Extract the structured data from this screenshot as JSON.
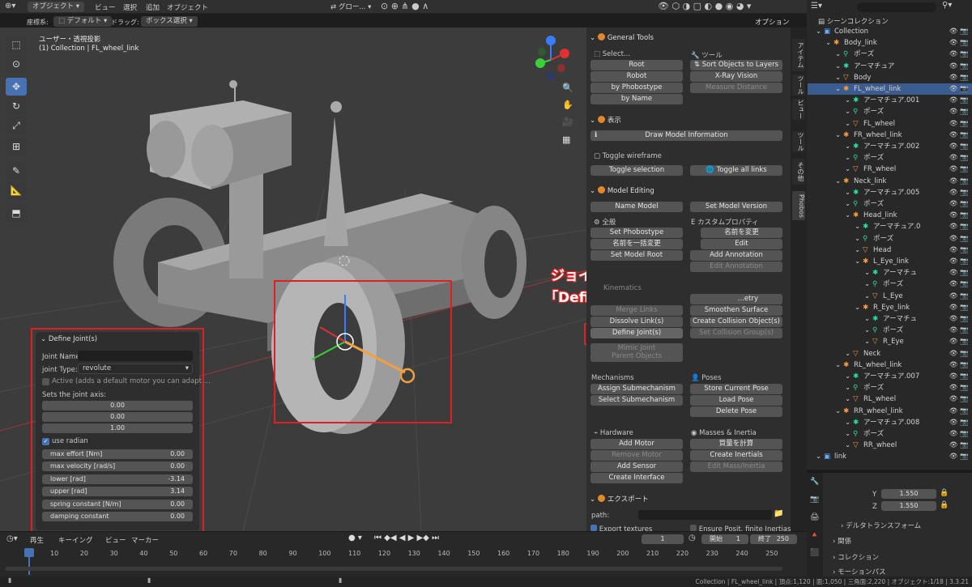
{
  "topbar": {
    "mode": "オブジェクト",
    "menus": [
      "ビュー",
      "選択",
      "追加",
      "オブジェクト"
    ],
    "transform_global": "グロー...",
    "options": "オプション"
  },
  "toolbar2": {
    "coord_label": "座標系:",
    "coord_value": "デフォルト",
    "drag_label": "ドラッグ:",
    "drag_value": "ボックス選択"
  },
  "viewport": {
    "title": "ユーザー・透視投影",
    "subtitle": "(1) Collection | FL_wheel_link"
  },
  "annotation": {
    "line1": "ジョイントを選択後",
    "line2": "「Define Joint(s)」を押す"
  },
  "define_joint": {
    "title": "Define Joint(s)",
    "joint_name_label": "Joint Name:",
    "joint_name_value": "",
    "joint_type_label": "joint Type:",
    "joint_type_value": "revolute",
    "active_label": "Active (adds a default motor you can adapt ...",
    "axis_label": "Sets the joint axis:",
    "axis": [
      "0.00",
      "0.00",
      "1.00"
    ],
    "use_radian": "use radian",
    "fields": [
      {
        "k": "max effort [Nm]",
        "v": "0.00"
      },
      {
        "k": "max velocity [rad/s]",
        "v": "0.00"
      },
      {
        "k": "lower [rad]",
        "v": "-3.14"
      },
      {
        "k": "upper [rad]",
        "v": "3.14"
      },
      {
        "k": "spring constant [N/m]",
        "v": "0.00"
      },
      {
        "k": "damping constant",
        "v": "0.00"
      }
    ]
  },
  "phobos": {
    "general_tools": "General Tools",
    "select": "Select...",
    "tools": "ツール",
    "root": "Root",
    "sort_layers": "Sort Objects to Layers",
    "robot": "Robot",
    "xray": "X-Ray Vision",
    "by_phobostype": "by Phobostype",
    "measure": "Measure Distance",
    "by_name": "by Name",
    "display": "表示",
    "draw_model_info": "Draw Model Information",
    "toggle_wireframe": "Toggle wireframe",
    "toggle_selection": "Toggle selection",
    "toggle_all_links": "Toggle all links",
    "model_editing": "Model Editing",
    "name_model": "Name Model",
    "set_model_version": "Set Model Version",
    "general": "全般",
    "custom_props": "カスタムプロパティ",
    "set_phobostype": "Set Phobostype",
    "rename": "名前を変更",
    "batch_rename": "名前を一括変更",
    "edit": "Edit",
    "set_model_root": "Set Model Root",
    "add_annotation": "Add Annotation",
    "edit_annotation": "Edit Annotation",
    "kinematics": "Kinematics",
    "geometry": "...etry",
    "merge_links": "Merge Links",
    "smoothen_surface": "Smoothen Surface",
    "dissolve_links": "Dissolve Link(s)",
    "create_collision": "Create Collision Object(s)",
    "define_joints": "Define Joint(s)",
    "set_collision_groups": "Set Collision Group(s)",
    "mimic_joint": "Mimic Joint",
    "parent_objects": "Parent Objects",
    "mechanisms": "Mechanisms",
    "poses": "Poses",
    "assign_submech": "Assign Submechanism",
    "store_pose": "Store Current Pose",
    "select_submech": "Select Submechanism",
    "load_pose": "Load Pose",
    "delete_pose": "Delete Pose",
    "hardware": "Hardware",
    "masses": "Masses & Inertia",
    "add_motor": "Add Motor",
    "calc_mass": "質量を計算",
    "remove_motor": "Remove Motor",
    "create_inertials": "Create Inertials",
    "add_sensor": "Add Sensor",
    "edit_mass": "Edit Mass/Inertia",
    "create_interface": "Create Interface",
    "export": "エクスポート",
    "path": "path:",
    "export_textures": "Export textures",
    "ensure_posit": "Ensure Posit. finite Inertias"
  },
  "vtabs": [
    "アイテム",
    "ツール",
    "ビュー",
    "ツール",
    "その他",
    "Phobos"
  ],
  "outliner": {
    "header": "シーンコレクション",
    "rows": [
      {
        "t": "Collection",
        "d": 0,
        "c": "ic-b",
        "i": "▣"
      },
      {
        "t": "Body_link",
        "d": 1,
        "c": "ic-o",
        "i": "✱"
      },
      {
        "t": "ポーズ",
        "d": 2,
        "c": "ic-g",
        "i": "⚲"
      },
      {
        "t": "アーマチュア",
        "d": 2,
        "c": "ic-g",
        "i": "✱"
      },
      {
        "t": "Body",
        "d": 2,
        "c": "ic-o",
        "i": "▽"
      },
      {
        "t": "FL_wheel_link",
        "d": 2,
        "c": "ic-o",
        "i": "✱",
        "sel": true
      },
      {
        "t": "アーマチュア.001",
        "d": 3,
        "c": "ic-g",
        "i": "✱"
      },
      {
        "t": "ポーズ",
        "d": 3,
        "c": "ic-g",
        "i": "⚲"
      },
      {
        "t": "FL_wheel",
        "d": 3,
        "c": "ic-o",
        "i": "▽"
      },
      {
        "t": "FR_wheel_link",
        "d": 2,
        "c": "ic-o",
        "i": "✱"
      },
      {
        "t": "アーマチュア.002",
        "d": 3,
        "c": "ic-g",
        "i": "✱"
      },
      {
        "t": "ポーズ",
        "d": 3,
        "c": "ic-g",
        "i": "⚲"
      },
      {
        "t": "FR_wheel",
        "d": 3,
        "c": "ic-o",
        "i": "▽"
      },
      {
        "t": "Neck_link",
        "d": 2,
        "c": "ic-o",
        "i": "✱"
      },
      {
        "t": "アーマチュア.005",
        "d": 3,
        "c": "ic-g",
        "i": "✱"
      },
      {
        "t": "ポーズ",
        "d": 3,
        "c": "ic-g",
        "i": "⚲"
      },
      {
        "t": "Head_link",
        "d": 3,
        "c": "ic-o",
        "i": "✱"
      },
      {
        "t": "アーマチュア.0",
        "d": 4,
        "c": "ic-g",
        "i": "✱"
      },
      {
        "t": "ポーズ",
        "d": 4,
        "c": "ic-g",
        "i": "⚲"
      },
      {
        "t": "Head",
        "d": 4,
        "c": "ic-o",
        "i": "▽"
      },
      {
        "t": "L_Eye_link",
        "d": 4,
        "c": "ic-o",
        "i": "✱"
      },
      {
        "t": "アーマチュ",
        "d": 5,
        "c": "ic-g",
        "i": "✱"
      },
      {
        "t": "ポーズ",
        "d": 5,
        "c": "ic-g",
        "i": "⚲"
      },
      {
        "t": "L_Eye",
        "d": 5,
        "c": "ic-o",
        "i": "▽"
      },
      {
        "t": "R_Eye_link",
        "d": 4,
        "c": "ic-o",
        "i": "✱"
      },
      {
        "t": "アーマチュ",
        "d": 5,
        "c": "ic-g",
        "i": "✱"
      },
      {
        "t": "ポーズ",
        "d": 5,
        "c": "ic-g",
        "i": "⚲"
      },
      {
        "t": "R_Eye",
        "d": 5,
        "c": "ic-o",
        "i": "▽"
      },
      {
        "t": "Neck",
        "d": 3,
        "c": "ic-o",
        "i": "▽"
      },
      {
        "t": "RL_wheel_link",
        "d": 2,
        "c": "ic-o",
        "i": "✱"
      },
      {
        "t": "アーマチュア.007",
        "d": 3,
        "c": "ic-g",
        "i": "✱"
      },
      {
        "t": "ポーズ",
        "d": 3,
        "c": "ic-g",
        "i": "⚲"
      },
      {
        "t": "RL_wheel",
        "d": 3,
        "c": "ic-o",
        "i": "▽"
      },
      {
        "t": "RR_wheel_link",
        "d": 2,
        "c": "ic-o",
        "i": "✱"
      },
      {
        "t": "アーマチュア.008",
        "d": 3,
        "c": "ic-g",
        "i": "✱"
      },
      {
        "t": "ポーズ",
        "d": 3,
        "c": "ic-g",
        "i": "⚲"
      },
      {
        "t": "RR_wheel",
        "d": 3,
        "c": "ic-o",
        "i": "▽"
      },
      {
        "t": "link",
        "d": 0,
        "c": "ic-b",
        "i": "▣"
      }
    ]
  },
  "properties": {
    "y_label": "Y",
    "y_value": "1.550",
    "z_label": "Z",
    "z_value": "1.550",
    "delta": "デルタトランスフォーム",
    "relations": "関係",
    "collection": "コレクション",
    "motion_path": "モーションパス"
  },
  "timeline": {
    "menus": [
      "再生",
      "キーイング",
      "ビュー",
      "マーカー"
    ],
    "frame": "1",
    "start_label": "開始",
    "start": "1",
    "end_label": "終了",
    "end": "250",
    "ticks": [
      "1",
      "10",
      "20",
      "30",
      "40",
      "50",
      "60",
      "70",
      "80",
      "90",
      "100",
      "110",
      "120",
      "130",
      "140",
      "150",
      "160",
      "170",
      "180",
      "190",
      "200",
      "210",
      "220",
      "230",
      "240",
      "250"
    ]
  },
  "statusbar": "Collection | FL_wheel_link | 頂点:1,120 | 面:1,050 | 三角面:2,220 | オブジェクト:1/18 | 3.3.21"
}
